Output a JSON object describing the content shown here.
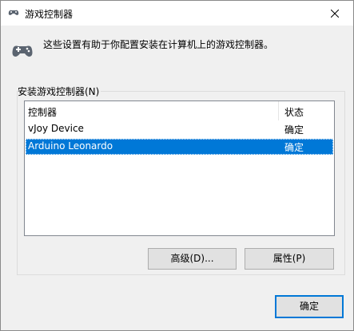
{
  "window": {
    "title": "游戏控制器",
    "close_icon": "close-icon"
  },
  "header": {
    "description": "这些设置有助于你配置安装在计算机上的游戏控制器。",
    "icon": "gamepad-icon"
  },
  "group": {
    "label": "安装游戏控制器(N)"
  },
  "controllers": {
    "columns": [
      "控制器",
      "状态"
    ],
    "rows": [
      {
        "name": "vJoy Device",
        "status": "确定"
      },
      {
        "name": "Arduino Leonardo",
        "status": "确定",
        "selected": true
      }
    ]
  },
  "buttons": {
    "advanced": "高级(D)...",
    "properties": "属性(P)",
    "ok": "确定"
  },
  "colors": {
    "selection": "#0078d7",
    "background": "#f0f0f0"
  }
}
